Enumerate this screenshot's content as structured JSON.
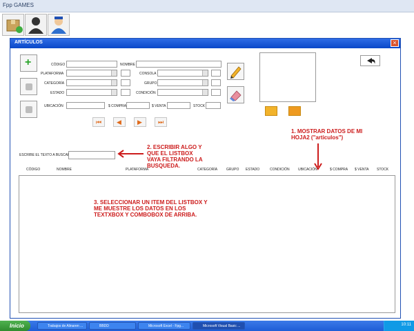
{
  "window": {
    "title": "Fpp GAMES"
  },
  "dialog": {
    "title": "ARTÍCULOS",
    "close_label": "×"
  },
  "form": {
    "codigo": "CÓDIGO",
    "nombre": "NOMBRE",
    "plataforma": "PLATAFORMA",
    "consola": "CONSOLA",
    "categoria": "CATEGORÍA",
    "grupo": "GRUPO",
    "estado": "ESTADO",
    "condicion": "CONDICIÓN",
    "ubicacion": "UBICACIÓN",
    "compra": "$ COMPRA",
    "venta": "$ VENTA",
    "stock": "STOCK",
    "search_label": "ESCRIBE EL TEXTO A BUSCAR:"
  },
  "list_headers": [
    "CÓDIGO",
    "NOMBRE",
    "PLATAFORMA",
    "CATEGORÍA",
    "GRUPO",
    "ESTADO",
    "CONDICIÓN",
    "UBICACIÓN",
    "$ COMPRA",
    "$ VENTA",
    "STOCK"
  ],
  "notes": {
    "note1": "1. MOSTRAR DATOS DE MI HOJA2 (\"articulos\")",
    "note2": "2. ESCRIBIR ALGO Y QUE EL LISTBOX VAYA FILTRANDO LA BUSQUEDA.",
    "note3": "3. SELECCIONAR UN ITEM DEL LISTBOX Y ME MUESTRE LOS DATOS EN LOS TEXTXBOX Y COMBOBOX DE ARRIBA."
  },
  "taskbar": {
    "start": "Inicio",
    "tasks": [
      "Trabajos de Alinaren ...",
      "BBDD",
      "Microsoft Excel - Fpg...",
      "Microsoft Visual Basic ..."
    ],
    "clock": "10:11"
  },
  "colors": {
    "accent": "#0a48c8",
    "note": "#cc1b1b"
  }
}
